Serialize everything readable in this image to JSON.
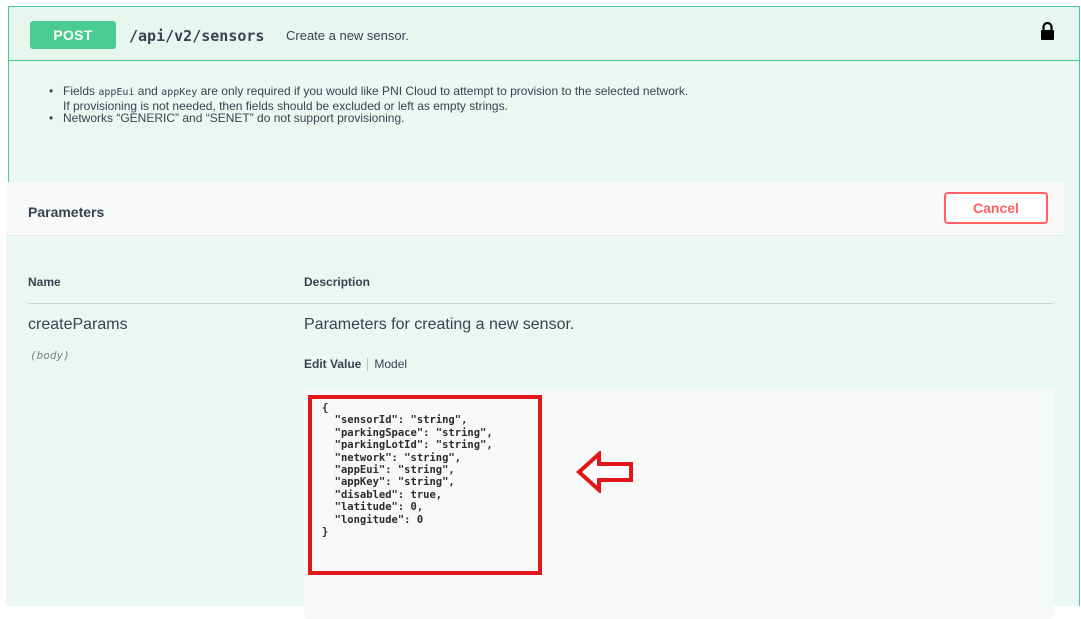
{
  "operation": {
    "method": "POST",
    "path": "/api/v2/sensors",
    "summary": "Create a new sensor.",
    "icon": "lock-icon",
    "color": "#49cc90"
  },
  "description": {
    "item1": {
      "before_code1": "Fields ",
      "code1": "appEui",
      "between": " and ",
      "code2": "appKey",
      "after": " are only required if you would like PNI Cloud to attempt to provision to the selected network. If provisioning is not needed, then fields should be excluded or left as empty strings."
    },
    "item2": "Networks “GENERIC” and “SENET” do not support provisioning."
  },
  "parameters": {
    "title": "Parameters",
    "cancel_label": "Cancel",
    "col_name": "Name",
    "col_description": "Description",
    "param": {
      "name": "createParams",
      "in": "(body)",
      "description": "Parameters for creating a new sensor.",
      "tab_edit": "Edit Value",
      "tab_model": "Model",
      "body": "{\n  \"sensorId\": \"string\",\n  \"parkingSpace\": \"string\",\n  \"parkingLotId\": \"string\",\n  \"network\": \"string\",\n  \"appEui\": \"string\",\n  \"appKey\": \"string\",\n  \"disabled\": true,\n  \"latitude\": 0,\n  \"longitude\": 0\n}"
    }
  },
  "annotation": {
    "highlight_color": "#e3161c",
    "arrow_icon": "left-arrow-icon"
  }
}
